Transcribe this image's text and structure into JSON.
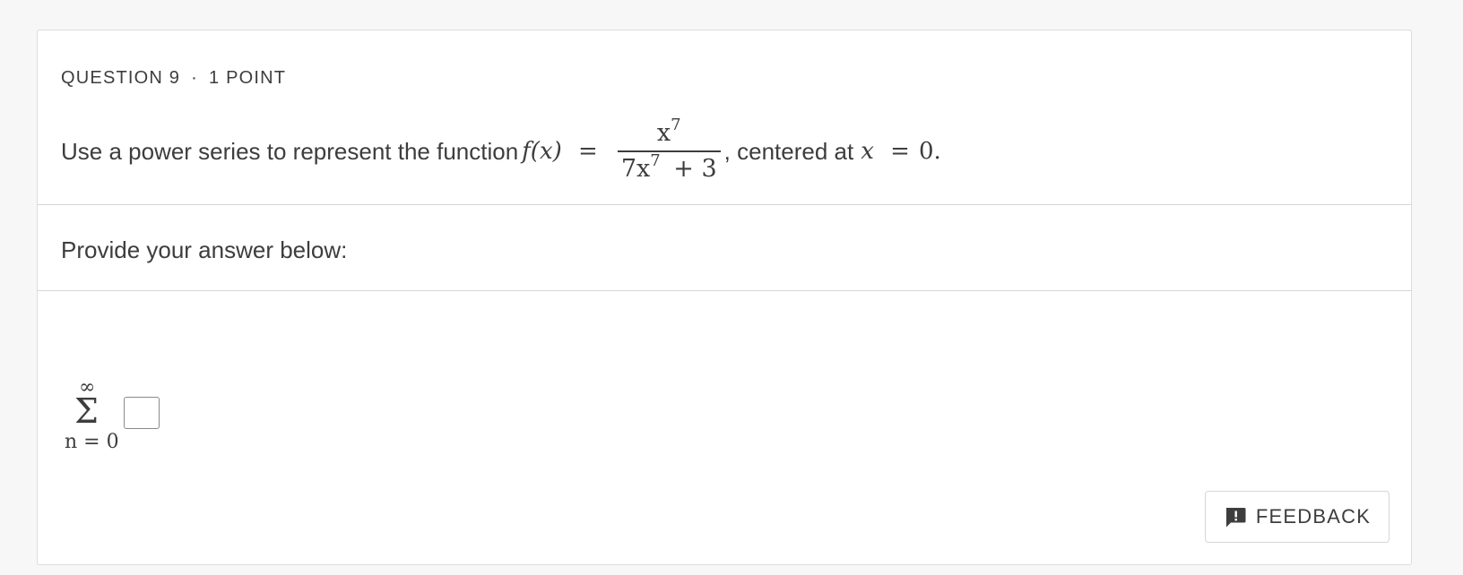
{
  "question": {
    "number_label": "QUESTION 9",
    "separator": "·",
    "points_label": "1 POINT",
    "prompt_text": "Use a power series to represent the function",
    "function_lhs": "f(x)",
    "equals": "=",
    "numerator_base": "x",
    "numerator_exp": "7",
    "denominator_coeff": "7",
    "denominator_base": "x",
    "denominator_exp": "7",
    "denominator_tail": "+ 3",
    "after_fraction": ", centered at",
    "center_var": "x",
    "center_equals": "=",
    "center_value": "0."
  },
  "answer": {
    "label": "Provide your answer below:",
    "sum_upper": "∞",
    "sum_symbol": "Σ",
    "sum_lower": "n = 0",
    "input_value": ""
  },
  "feedback_button": {
    "label": "FEEDBACK",
    "icon": "feedback-alert-icon"
  }
}
